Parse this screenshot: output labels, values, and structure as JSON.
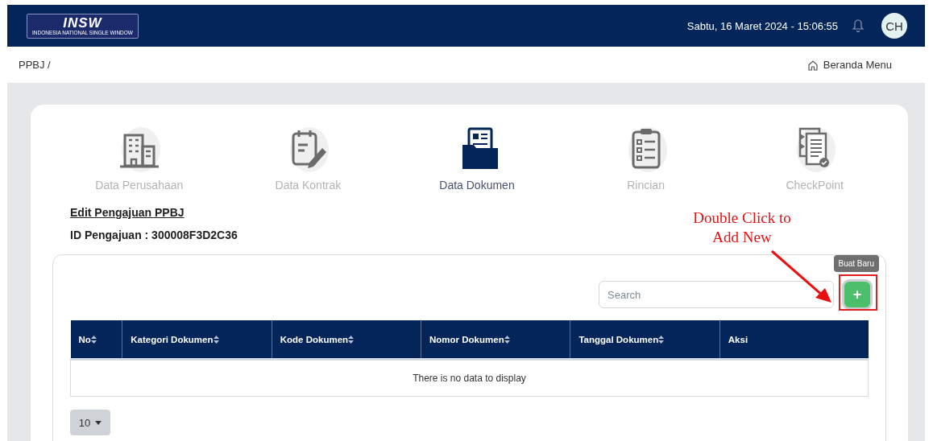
{
  "header": {
    "logo": {
      "mark": "INSW",
      "tagline": "INDONESIA NATIONAL SINGLE WINDOW"
    },
    "datetime": "Sabtu, 16 Maret 2024 - 15:06:55",
    "avatar": "CH"
  },
  "breadcrumb": "PPBJ /",
  "home_link": "Beranda Menu",
  "steps": [
    {
      "label": "Data Perusahaan",
      "selected": false
    },
    {
      "label": "Data Kontrak",
      "selected": false
    },
    {
      "label": "Data Dokumen",
      "selected": true
    },
    {
      "label": "Rincian",
      "selected": false
    },
    {
      "label": "CheckPoint",
      "selected": false
    }
  ],
  "form_title": "Edit Pengajuan PPBJ",
  "submission_id": "ID Pengajuan : 300008F3D2C36",
  "search": {
    "placeholder": "Search"
  },
  "add_button": {
    "label": "+",
    "tooltip": "Buat Baru"
  },
  "table": {
    "columns": [
      {
        "label": "No",
        "sortable": true
      },
      {
        "label": "Kategori Dokumen",
        "sortable": true
      },
      {
        "label": "Kode Dokumen",
        "sortable": true
      },
      {
        "label": "Nomor Dokumen",
        "sortable": true
      },
      {
        "label": "Tanggal Dokumen",
        "sortable": true
      },
      {
        "label": "Aksi",
        "sortable": false
      }
    ],
    "empty_message": "There is no data to display"
  },
  "page_size": "10",
  "annotation": {
    "text": "Double Click to Add New"
  }
}
